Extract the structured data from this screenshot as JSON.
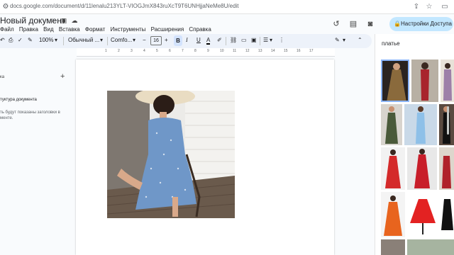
{
  "browser": {
    "url": "docs.google.com/document/d/11lenalu213YLT-VIOGJmX843ruXcT9T6UNHjjaNeMe8U/edit"
  },
  "doc": {
    "title": "Новый документ",
    "menus": [
      "Файл",
      "Правка",
      "Вид",
      "Вставка",
      "Формат",
      "Инструменты",
      "Расширения",
      "Справка"
    ]
  },
  "share": {
    "label": "Настройки Доступа"
  },
  "toolbar": {
    "zoom": "100%",
    "style": "Обычный ...",
    "font": "Comfo...",
    "font_size": "16",
    "bold": "B",
    "italic": "I",
    "underline": "U",
    "text_color": "A"
  },
  "ruler": {
    "marks": [
      "1",
      "2",
      "3",
      "4",
      "5",
      "6",
      "7",
      "8",
      "9",
      "10",
      "11",
      "12",
      "13",
      "14",
      "15",
      "16",
      "17"
    ]
  },
  "outline": {
    "heading": "ка",
    "title": "туктура документа",
    "description": "ть будут показаны заголовки в менте."
  },
  "search": {
    "query": "платье"
  },
  "colors": {
    "share_bg": "#c2e7ff",
    "toolbar_bg": "#edf2fa",
    "bold_active": "#d3e3fd",
    "dress_blue": "#6f97c8"
  }
}
